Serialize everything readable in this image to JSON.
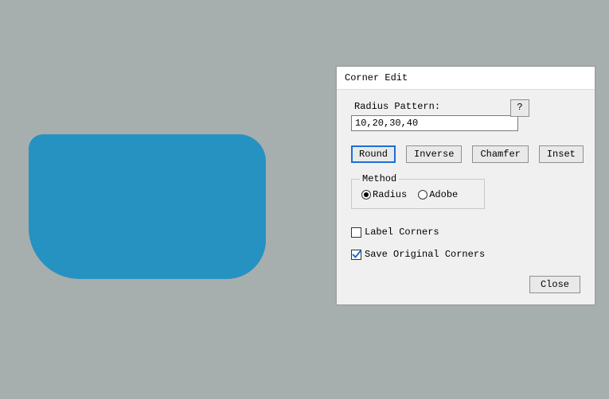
{
  "preview": {
    "fill": "#2592c2",
    "radii": {
      "tl": 10,
      "tr": 20,
      "br": 30,
      "bl": 40
    }
  },
  "dialog": {
    "title": "Corner Edit",
    "radius_pattern_label": "Radius Pattern:",
    "help_label": "?",
    "radius_pattern_value": "10,20,30,40",
    "type_buttons": {
      "round": "Round",
      "inverse": "Inverse",
      "chamfer": "Chamfer",
      "inset": "Inset",
      "active": "round"
    },
    "method": {
      "legend": "Method",
      "radius_label": "Radius",
      "adobe_label": "Adobe",
      "selected": "radius"
    },
    "label_corners": {
      "text": "Label Corners",
      "checked": false
    },
    "save_original": {
      "text": "Save Original Corners",
      "checked": true
    },
    "close_label": "Close"
  }
}
